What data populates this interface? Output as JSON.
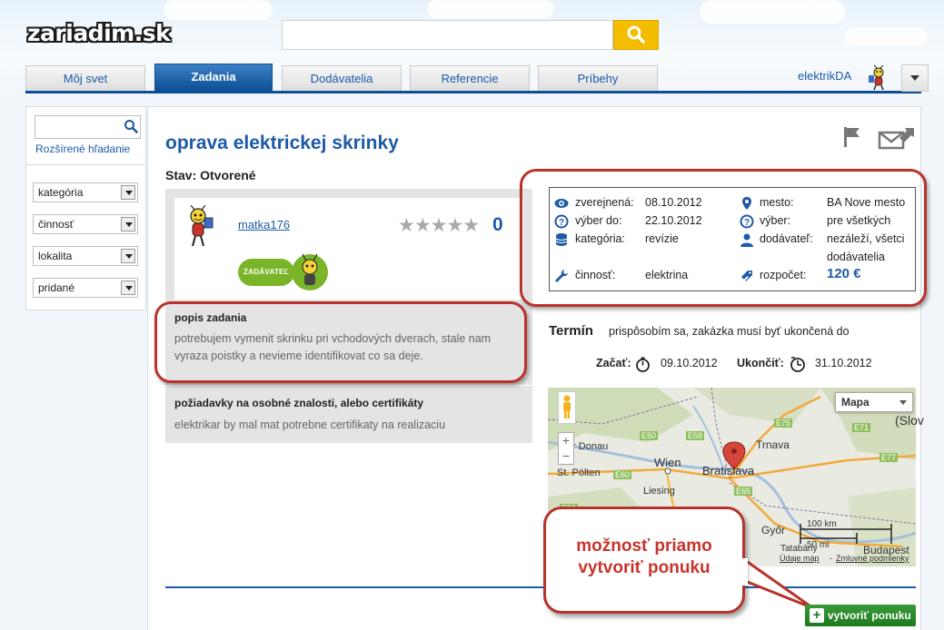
{
  "header": {
    "logo": "zariadim.sk",
    "search_value": ""
  },
  "nav": {
    "tabs": [
      "Môj svet",
      "Zadania",
      "Dodávatelia",
      "Referencie",
      "Príbehy"
    ],
    "active_tab": "Zadania"
  },
  "user": {
    "name": "elektrikDA"
  },
  "sidebar": {
    "search_value": "",
    "advanced_link": "Rozšírené hľadanie",
    "filters": [
      "kategória",
      "činnosť",
      "lokalita",
      "pridané"
    ]
  },
  "task": {
    "title": "oprava elektrickej skrinky",
    "status": "Stav: Otvorené",
    "author": "matka176",
    "rating": "★★★★★",
    "score": "0",
    "badge": "ZADÁVATEĽ",
    "desc_heading": "popis zadania",
    "desc_text": "potrebujem vymenit skrinku pri vchodových dverach, stale nam vyraza poistky a nevieme identifikovat co sa deje.",
    "req_heading": "požiadavky na osobné znalosti, alebo certifikáty",
    "req_text": "elektrikar by mal mat potrebne certifikaty na realizaciu"
  },
  "info": {
    "zverejnena_label": "zverejnená:",
    "zverejnena": "08.10.2012",
    "vyber_do_label": "výber do:",
    "vyber_do": "22.10.2012",
    "kategoria_label": "kategória:",
    "kategoria": "revízie",
    "cinnost_label": "činnosť:",
    "cinnost": "elektrina",
    "mesto_label": "mesto:",
    "mesto": "BA Nove mesto",
    "vyber_label": "výber:",
    "vyber": "pre všetkých",
    "dodavatel_label": "dodávateľ:",
    "dodavatel_1": "nezáleží, všetci",
    "dodavatel_2": "dodávatelia",
    "rozpocet_label": "rozpočet:",
    "rozpocet": "120 €"
  },
  "termin": {
    "heading": "Termín",
    "text": "prispôsobím sa, zakázka musí byť ukončená do",
    "start_label": "Začať:",
    "start": "09.10.2012",
    "end_label": "Ukončiť:",
    "end": "31.10.2012"
  },
  "map": {
    "type": "Mapa",
    "labels": [
      "(Slov",
      "Trnava",
      "Wien",
      "Bratislava",
      "Der Donau",
      "St. Pölten",
      "Liesing",
      "Győr",
      "Tatabány",
      "Budapest",
      "E50",
      "E58",
      "E60",
      "E75",
      "E71",
      "E77",
      "E65",
      "E59"
    ],
    "scale_km": "100 km",
    "scale_mi": "50 mi",
    "footer_1": "Údaje máp",
    "footer_2": "Zmluvné podmienky"
  },
  "callout": {
    "line1": "možnosť priamo",
    "line2": "vytvoriť ponuku"
  },
  "actions": {
    "create_offer": "vytvoriť ponuku"
  }
}
